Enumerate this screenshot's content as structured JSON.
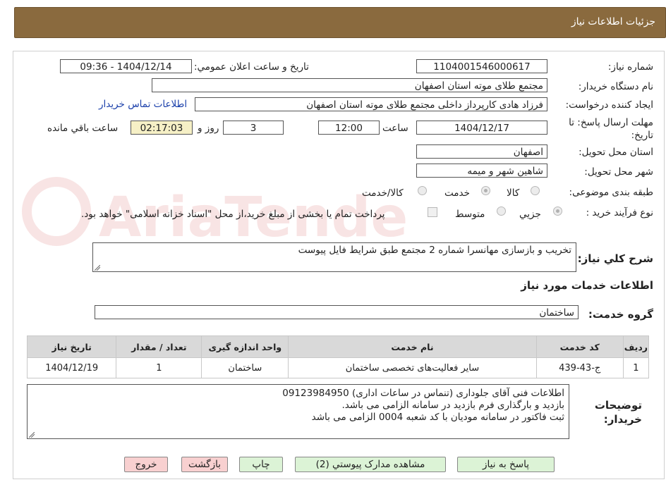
{
  "header": {
    "title": "جزئيات اطلاعات نياز"
  },
  "form": {
    "need_number_label": "شماره نياز:",
    "need_number": "1104001546000617",
    "announce_label": "تاريخ و ساعت اعلان عمومي:",
    "announce_value": "1404/12/14 - 09:36",
    "buyer_org_label": "نام دستگاه خريدار:",
    "buyer_org": "مجتمع طلای موته استان اصفهان",
    "requester_label": "ايجاد کننده درخواست:",
    "requester": "فرزاد هادی کارپرداز داخلی مجتمع طلای موته استان اصفهان",
    "contact_link": "اطلاعات تماس خريدار",
    "deadline_label_line1": "مهلت ارسال پاسخ: تا",
    "deadline_label_line2": "تاريخ:",
    "deadline_date": "1404/12/17",
    "time_label": "ساعت",
    "deadline_time": "12:00",
    "days_value": "3",
    "days_label": "روز و",
    "remaining_value": "02:17:03",
    "remaining_label": "ساعت باقي مانده",
    "province_label": "استان محل تحويل:",
    "province": "اصفهان",
    "city_label": "شهر محل تحويل:",
    "city": "شاهين شهر و ميمه",
    "category_label": "طبقه بندی موضوعی:",
    "category_options": [
      "کالا",
      "خدمت",
      "کالا/خدمت"
    ],
    "category_selected": "خدمت",
    "process_label": "نوع فرآيند خريد :",
    "process_options": [
      "جزيي",
      "متوسط"
    ],
    "process_selected": "جزيي",
    "treasury_note": "پرداخت تمام يا بخشی از مبلغ خريد،از محل \"اسناد خزانه اسلامی\" خواهد بود.",
    "summary_label": "شرح کلي نياز:",
    "summary": "تخریب و بازسازی مهانسرا شماره 2 مجتمع طبق شرایط فایل پیوست",
    "services_heading": "اطلاعات خدمات مورد نياز",
    "service_group_label": "گروه خدمت:",
    "service_group": "ساختمان"
  },
  "table": {
    "headers": [
      "رديف",
      "کد خدمت",
      "نام خدمت",
      "واحد اندازه گيری",
      "تعداد / مقدار",
      "تاريخ نياز"
    ],
    "rows": [
      [
        "1",
        "ج-43-439",
        "ساير فعاليت‌های تخصصی ساختمان",
        "ساختمان",
        "1",
        "1404/12/19"
      ]
    ]
  },
  "notes": {
    "label_line1": "توضيحات",
    "label_line2": "خريدار:",
    "lines": [
      "اطلاعات فنی آقای جلوداری (تنماس در ساعات اداری) 09123984950",
      "بازدید و بارگذاری فرم بازدید در سامانه الزامی می باشد.",
      "ثبت فاکتور در سامانه مودیان با کد شعبه 0004 الزامی می باشد"
    ]
  },
  "buttons": {
    "reply": "پاسخ به نياز",
    "attachments": "مشاهده مدارک پيوستي (2)",
    "print": "چاپ",
    "back": "بازگشت",
    "exit": "خروج"
  },
  "watermark": "AriaTender.neT",
  "colors": {
    "header_bg": "#8a6a3e",
    "button_green": "#dcf3d6",
    "button_pink": "#f8d0d0",
    "remaining_bg": "#f6f0c6"
  }
}
